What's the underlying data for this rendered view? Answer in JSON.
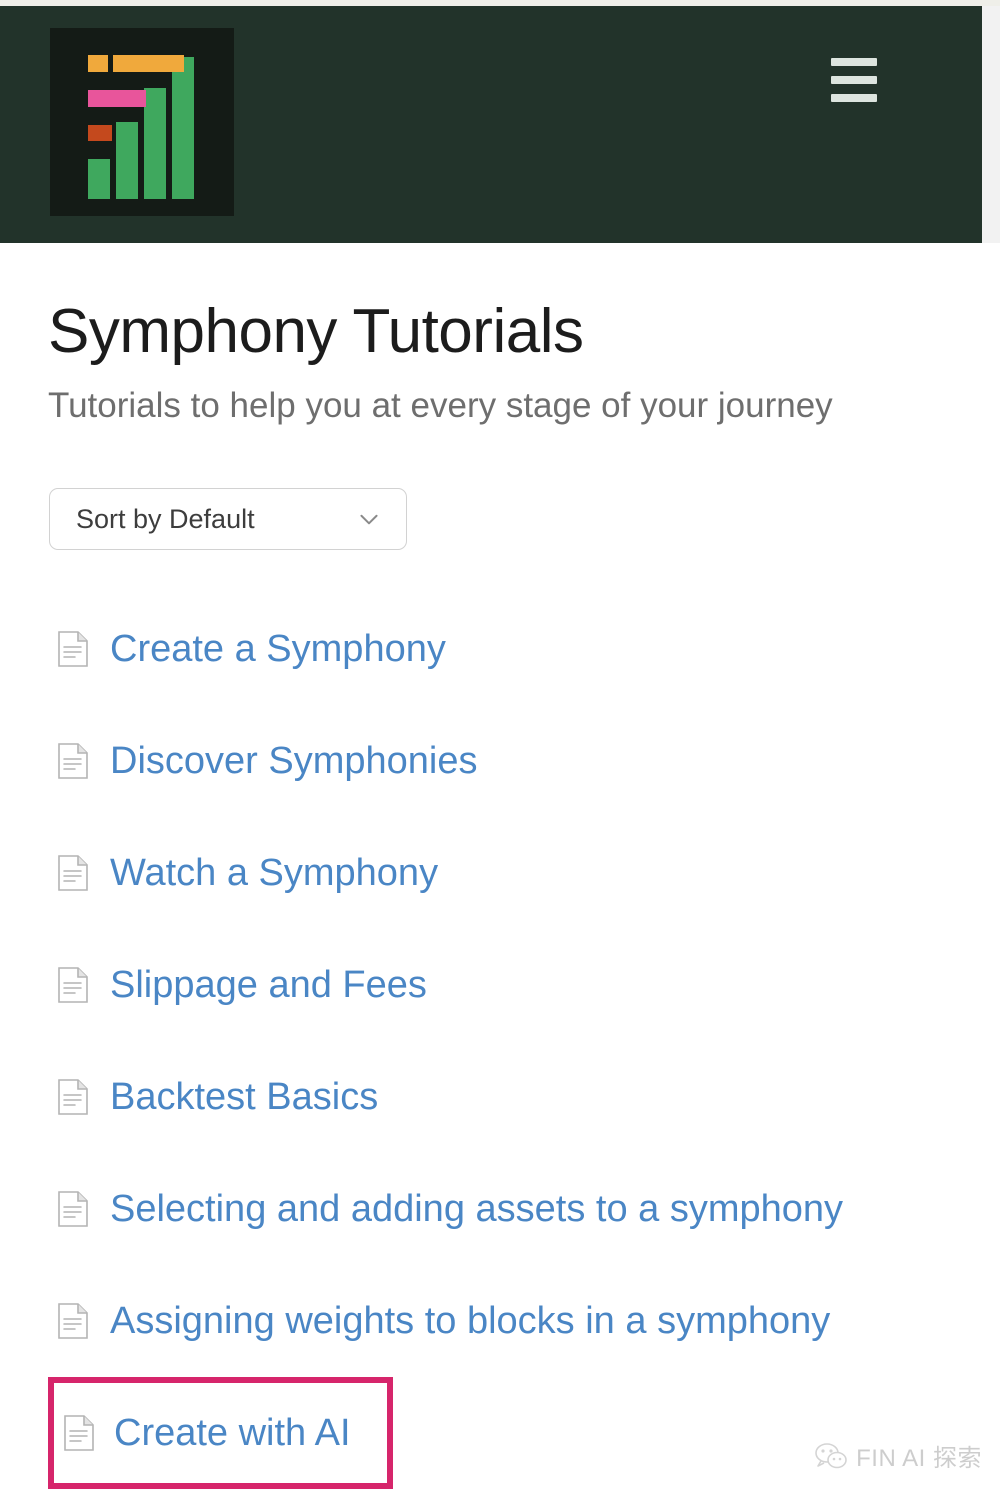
{
  "header": {
    "logo_name": "symphony-bar-chart-logo",
    "menu_label": "Menu",
    "background_color": "#22332a",
    "logo_tile_color": "#141b16",
    "logo_bar_colors": {
      "green": "#3fa85e",
      "orange": "#f0a93c",
      "pink": "#e8559b",
      "red_orange": "#c4491d"
    },
    "hamburger_color": "#dde5df"
  },
  "page": {
    "title": "Symphony Tutorials",
    "subtitle": "Tutorials to help you at every stage of your journey"
  },
  "sort": {
    "selected": "Sort by Default",
    "chevron_icon": "chevron-down-icon"
  },
  "tutorials": [
    {
      "label": "Create a Symphony",
      "icon": "document-icon",
      "highlighted": false
    },
    {
      "label": "Discover Symphonies",
      "icon": "document-icon",
      "highlighted": false
    },
    {
      "label": "Watch a Symphony",
      "icon": "document-icon",
      "highlighted": false
    },
    {
      "label": "Slippage and Fees",
      "icon": "document-icon",
      "highlighted": false
    },
    {
      "label": "Backtest Basics",
      "icon": "document-icon",
      "highlighted": false
    },
    {
      "label": "Selecting and adding assets to a symphony",
      "icon": "document-icon",
      "highlighted": false
    },
    {
      "label": "Assigning weights to blocks in a symphony",
      "icon": "document-icon",
      "highlighted": false
    },
    {
      "label": "Create with AI",
      "icon": "document-icon",
      "highlighted": true
    }
  ],
  "colors": {
    "link": "#4a86c5",
    "highlight_border": "#d6256b",
    "title": "#1c1c1c",
    "subtitle": "#6e6e6e"
  },
  "watermark": {
    "text": "FIN AI 探索",
    "icon": "wechat-icon"
  }
}
